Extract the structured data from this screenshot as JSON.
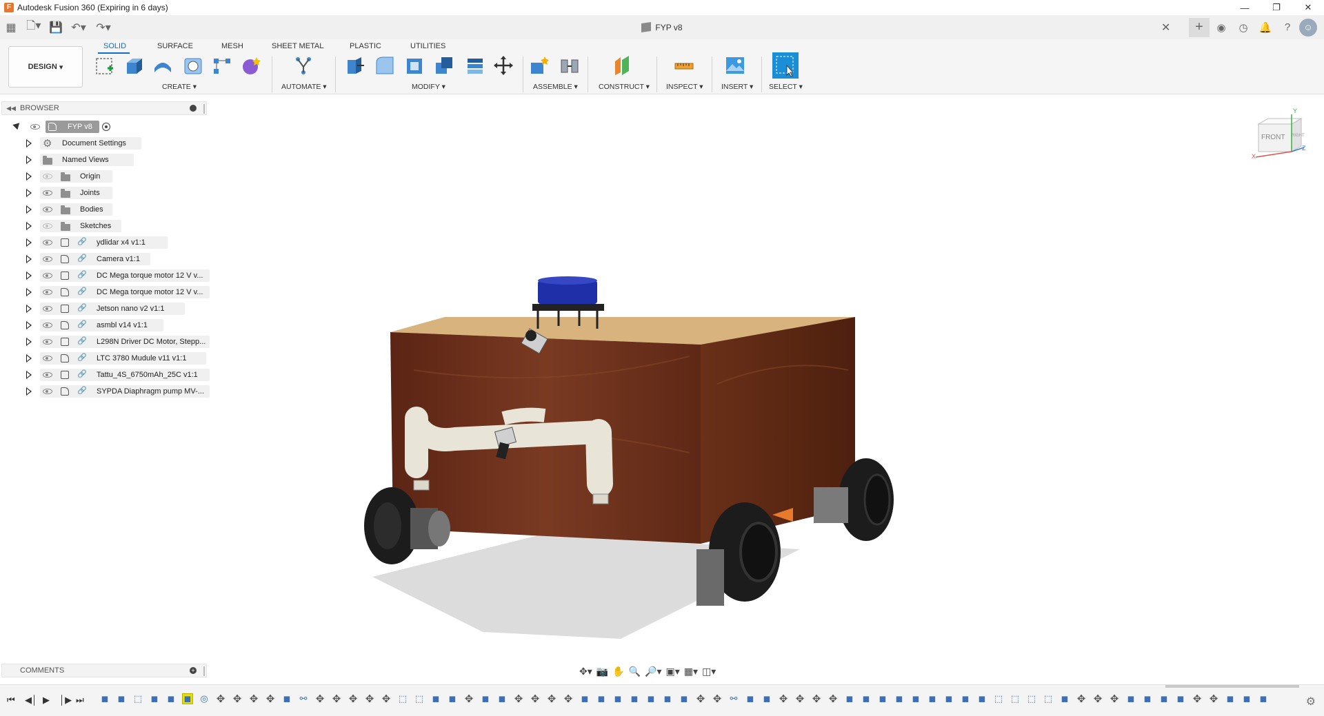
{
  "window": {
    "title": "Autodesk Fusion 360 (Expiring in 6 days)",
    "app_icon": "fusion-logo-icon",
    "buttons": [
      "minimize-icon",
      "restore-icon",
      "close-icon"
    ]
  },
  "document_tab": {
    "name": "FYP v8"
  },
  "ribbon": {
    "workspace_label": "DESIGN",
    "tabs": [
      "SOLID",
      "SURFACE",
      "MESH",
      "SHEET METAL",
      "PLASTIC",
      "UTILITIES"
    ],
    "active_tab": "SOLID",
    "groups": [
      "CREATE",
      "AUTOMATE",
      "MODIFY",
      "ASSEMBLE",
      "CONSTRUCT",
      "INSPECT",
      "INSERT",
      "SELECT"
    ]
  },
  "browser": {
    "title": "BROWSER",
    "root": "FYP v8",
    "items": [
      {
        "label": "Document Settings",
        "icon": "gear-icon"
      },
      {
        "label": "Named Views",
        "icon": "folder-icon"
      },
      {
        "label": "Origin",
        "icon": "folder-icon",
        "visible": false
      },
      {
        "label": "Joints",
        "icon": "folder-icon"
      },
      {
        "label": "Bodies",
        "icon": "folder-icon"
      },
      {
        "label": "Sketches",
        "icon": "folder-icon",
        "visible": false
      },
      {
        "label": "ydlidar x4 v1:1",
        "icon": "component-icon"
      },
      {
        "label": "Camera v1:1",
        "icon": "component-icon"
      },
      {
        "label": "DC Mega torque motor 12 V v...",
        "icon": "component-icon"
      },
      {
        "label": "DC Mega torque motor 12 V v...",
        "icon": "component-icon"
      },
      {
        "label": "Jetson nano v2 v1:1",
        "icon": "component-icon"
      },
      {
        "label": "asmbl v14 v1:1",
        "icon": "component-icon"
      },
      {
        "label": "L298N Driver DC Motor, Stepp...",
        "icon": "component-icon"
      },
      {
        "label": "LTC 3780 Mudule v11 v1:1",
        "icon": "component-icon"
      },
      {
        "label": "Tattu_4S_6750mAh_25C v1:1",
        "icon": "component-icon"
      },
      {
        "label": "SYPDA Diaphragm pump MV-...",
        "icon": "component-icon"
      }
    ]
  },
  "comments": {
    "title": "COMMENTS"
  },
  "viewcube": {
    "face": "FRONT",
    "right_face": "RIGHT",
    "axis_x": "X",
    "axis_y": "Y",
    "axis_z": "Z",
    "colors": {
      "x": "#e05050",
      "y": "#3cb043",
      "z": "#3a7bd5"
    }
  },
  "model": {
    "description_icon": "robot-chassis-model",
    "colors": {
      "wood": "#6b2f1a",
      "wood_top": "#d9b37e",
      "wheel": "#1c1c1c",
      "pipe": "#e8e4d8",
      "lidar": "#1f2fa8"
    }
  },
  "colors": {
    "accent": "#0f6fc6",
    "select_tool": "#1a8fd8",
    "timeline_highlight": "#e6e000"
  }
}
